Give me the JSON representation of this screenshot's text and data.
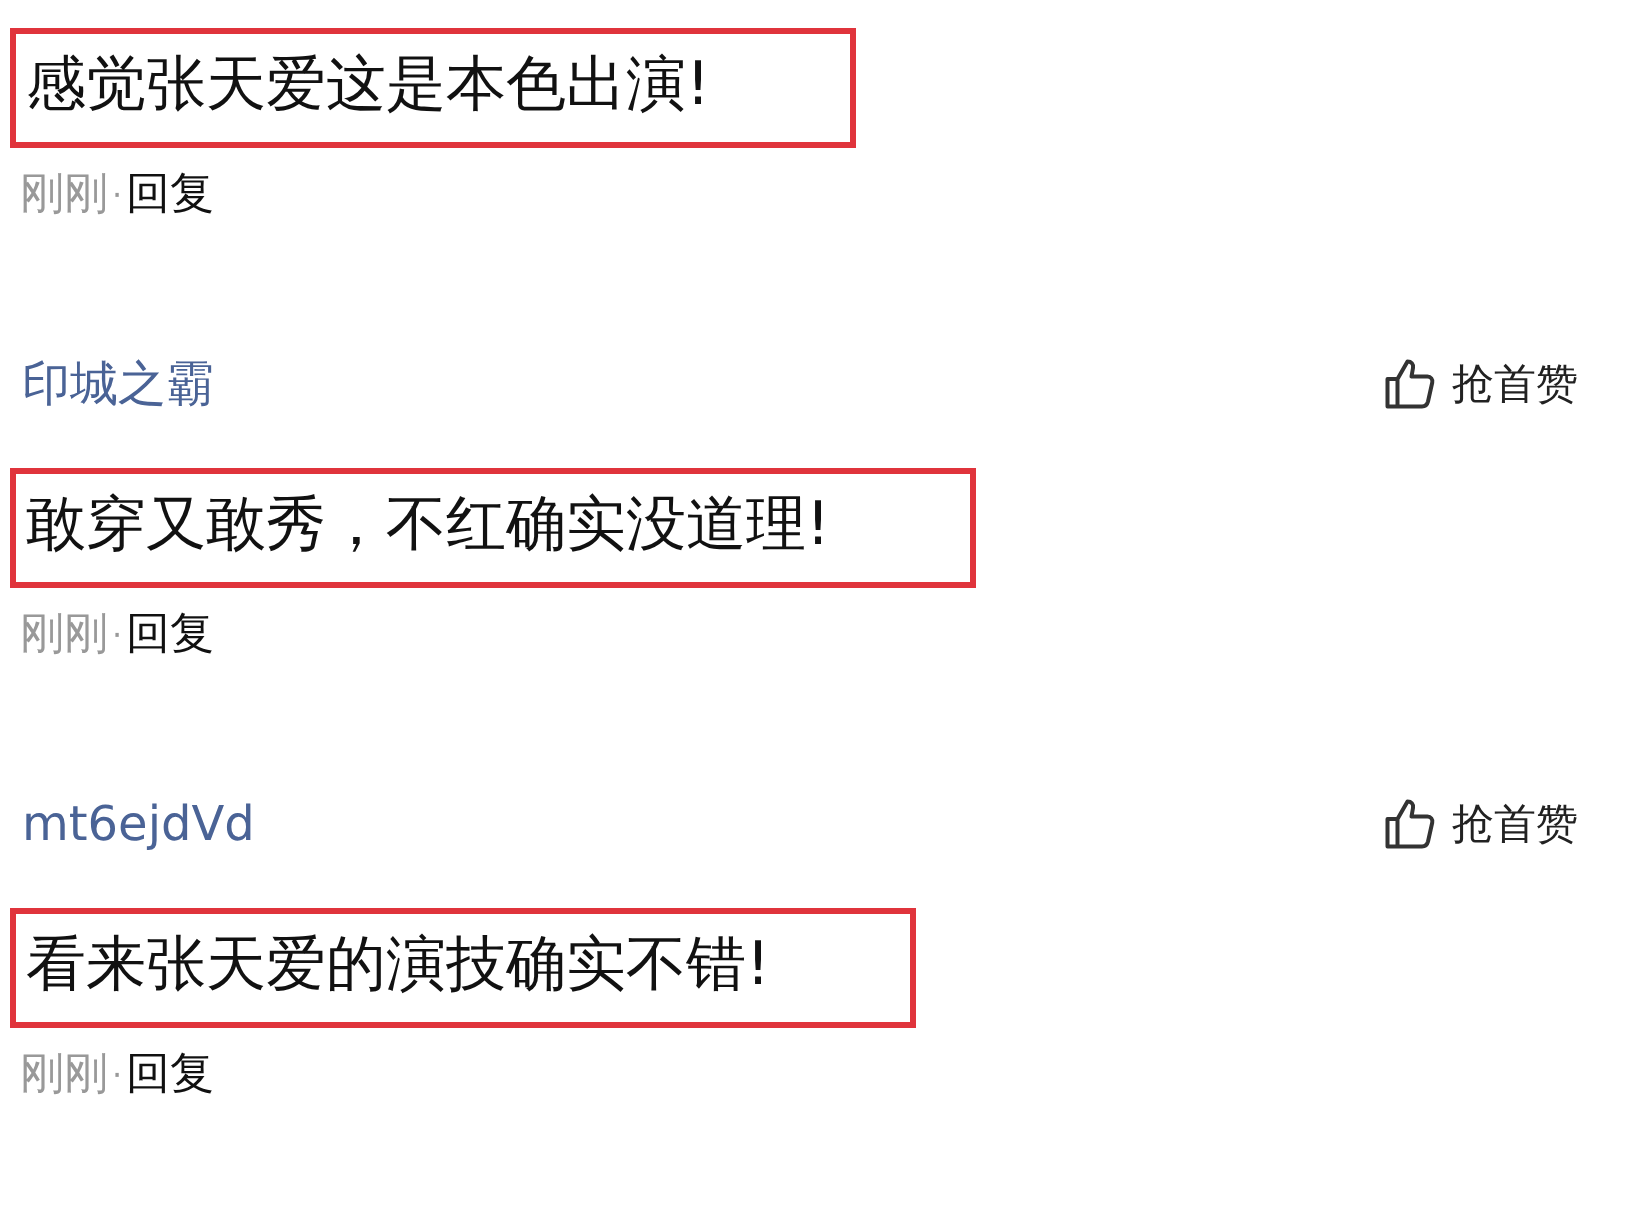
{
  "comments": [
    {
      "text": "感觉张天爱这是本色出演!",
      "highlighted": true,
      "time": "刚刚",
      "separator": "·",
      "reply": "回复"
    },
    {
      "author": "印城之霸",
      "like": "抢首赞",
      "text": "敢穿又敢秀，不红确实没道理!",
      "highlighted": true,
      "time": "刚刚",
      "separator": "·",
      "reply": "回复"
    },
    {
      "author": "mt6ejdVd",
      "like": "抢首赞",
      "text": "看来张天爱的演技确实不错!",
      "highlighted": true,
      "time": "刚刚",
      "separator": "·",
      "reply": "回复"
    }
  ]
}
